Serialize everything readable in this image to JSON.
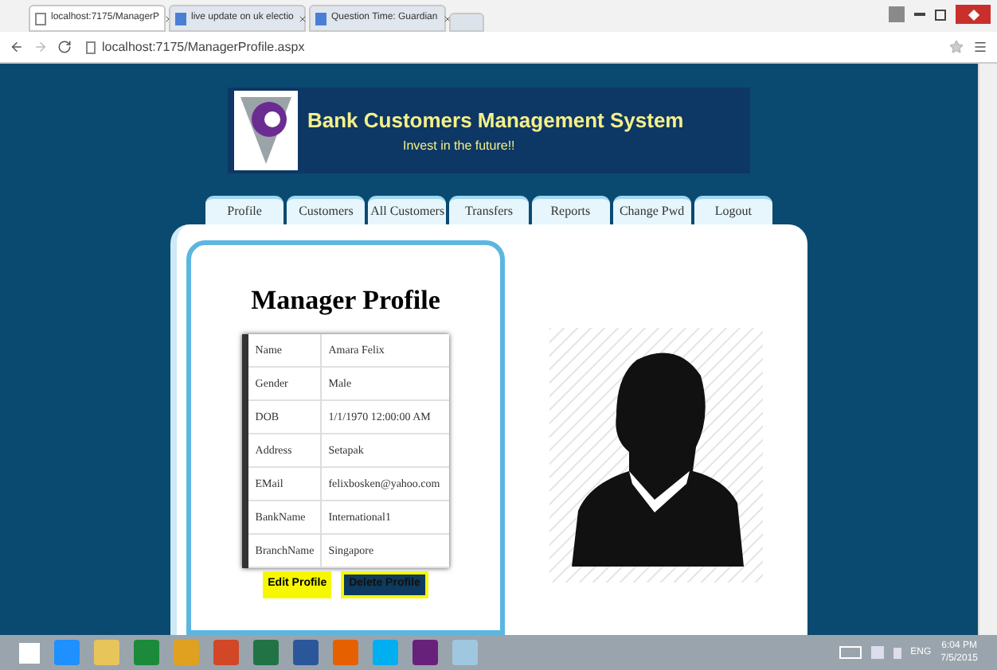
{
  "browser": {
    "tabs": [
      {
        "title": "localhost:7175/ManagerP",
        "selected": true
      },
      {
        "title": "live update on uk electio",
        "selected": false
      },
      {
        "title": "Question Time: Guardian",
        "selected": false
      }
    ],
    "address": "localhost:7175/ManagerProfile.aspx"
  },
  "header": {
    "title": "Bank Customers Management System",
    "tagline": "Invest in the future!!"
  },
  "nav": [
    "Profile",
    "Customers",
    "All Customers",
    "Transfers",
    "Reports",
    "Change Pwd",
    "Logout"
  ],
  "profile": {
    "heading": "Manager Profile",
    "rows": [
      {
        "label": "Name",
        "value": "Amara Felix"
      },
      {
        "label": "Gender",
        "value": "Male"
      },
      {
        "label": "DOB",
        "value": "1/1/1970 12:00:00 AM"
      },
      {
        "label": "Address",
        "value": "Setapak"
      },
      {
        "label": "EMail",
        "value": "felixbosken@yahoo.com"
      },
      {
        "label": "BankName",
        "value": "International1"
      },
      {
        "label": "BranchName",
        "value": "Singapore"
      }
    ],
    "buttons": [
      {
        "label": "Edit Profile",
        "kind": "light"
      },
      {
        "label": "Delete Profile",
        "kind": "dark"
      }
    ]
  },
  "taskbar": {
    "language": "ENG",
    "time": "6:04 PM",
    "date": "7/5/2015"
  }
}
